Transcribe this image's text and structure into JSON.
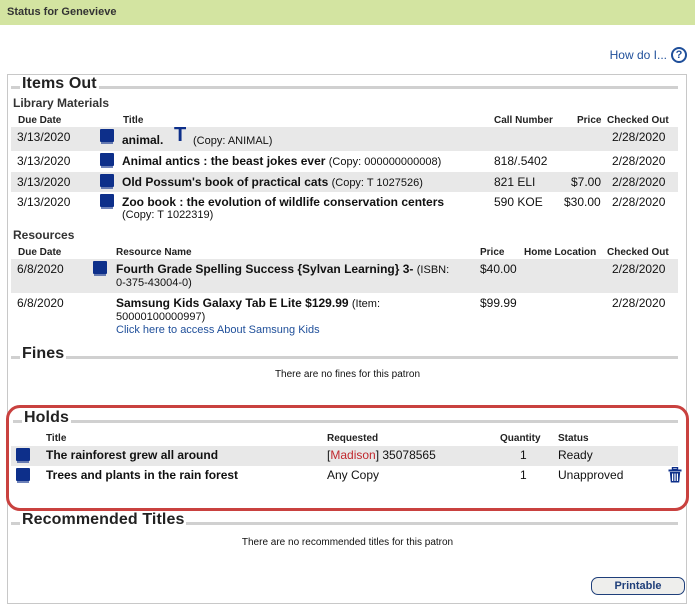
{
  "header": {
    "title": "Status for Genevieve"
  },
  "help": {
    "label": "How do I...",
    "icon": "help-circle-icon"
  },
  "items_out": {
    "title": "Items Out",
    "library_materials": {
      "title": "Library Materials",
      "columns": [
        "Due Date",
        "Title",
        "Call Number",
        "Price",
        "Checked Out"
      ],
      "rows": [
        {
          "due_date": "3/13/2020",
          "title": "animal.",
          "extra_icon": "T",
          "copy": "(Copy: ANIMAL)",
          "call_number": "",
          "price": "",
          "checked_out": "2/28/2020",
          "icon": "book-icon"
        },
        {
          "due_date": "3/13/2020",
          "title": "Animal antics : the beast jokes ever",
          "copy": "(Copy: 000000000008)",
          "call_number": "818/.5402",
          "price": "",
          "checked_out": "2/28/2020",
          "icon": "book-icon"
        },
        {
          "due_date": "3/13/2020",
          "title": "Old Possum's book of practical cats",
          "copy": "(Copy: T 1027526)",
          "call_number": "821 ELI",
          "price": "$7.00",
          "checked_out": "2/28/2020",
          "icon": "book-icon"
        },
        {
          "due_date": "3/13/2020",
          "title": "Zoo book : the evolution of wildlife conservation centers",
          "copy": "(Copy: T 1022319)",
          "call_number": "590 KOE",
          "price": "$30.00",
          "checked_out": "2/28/2020",
          "icon": "book-icon"
        }
      ]
    },
    "resources": {
      "title": "Resources",
      "columns": [
        "Due Date",
        "Resource Name",
        "Price",
        "Home Location",
        "Checked Out"
      ],
      "rows": [
        {
          "due_date": "6/8/2020",
          "name": "Fourth Grade Spelling Success {Sylvan Learning} 3-",
          "id_prefix": "(ISBN:",
          "id_rest": "0-375-43004-0)",
          "price": "$40.00",
          "home_location": "",
          "checked_out": "2/28/2020",
          "icon": "book-icon"
        },
        {
          "due_date": "6/8/2020",
          "name": "Samsung Kids Galaxy Tab E Lite $129.99",
          "id_prefix": "(Item:",
          "id_rest": "50000100000997)",
          "link": "Click here to access About Samsung Kids",
          "price": "$99.99",
          "home_location": "",
          "checked_out": "2/28/2020"
        }
      ]
    }
  },
  "fines": {
    "title": "Fines",
    "empty": "There are no fines for this patron"
  },
  "holds": {
    "title": "Holds",
    "columns": [
      "Title",
      "Requested",
      "Quantity",
      "Status"
    ],
    "rows": [
      {
        "title": "The rainforest grew all around",
        "requested_branch": "Madison",
        "requested_rest": "35078565",
        "quantity": "1",
        "status": "Ready",
        "icon": "book-icon"
      },
      {
        "title": "Trees and plants in the rain forest",
        "requested": "Any Copy",
        "quantity": "1",
        "status": "Unapproved",
        "icon": "book-icon",
        "action": "delete"
      }
    ]
  },
  "recommended": {
    "title": "Recommended Titles",
    "empty": "There are no recommended titles for this patron"
  },
  "printable_label": "Printable",
  "colors": {
    "accent": "#1f4f9a",
    "header_bg": "#d3e4a1",
    "highlight": "#c9413f",
    "icon_blue": "#0d2f8a"
  }
}
